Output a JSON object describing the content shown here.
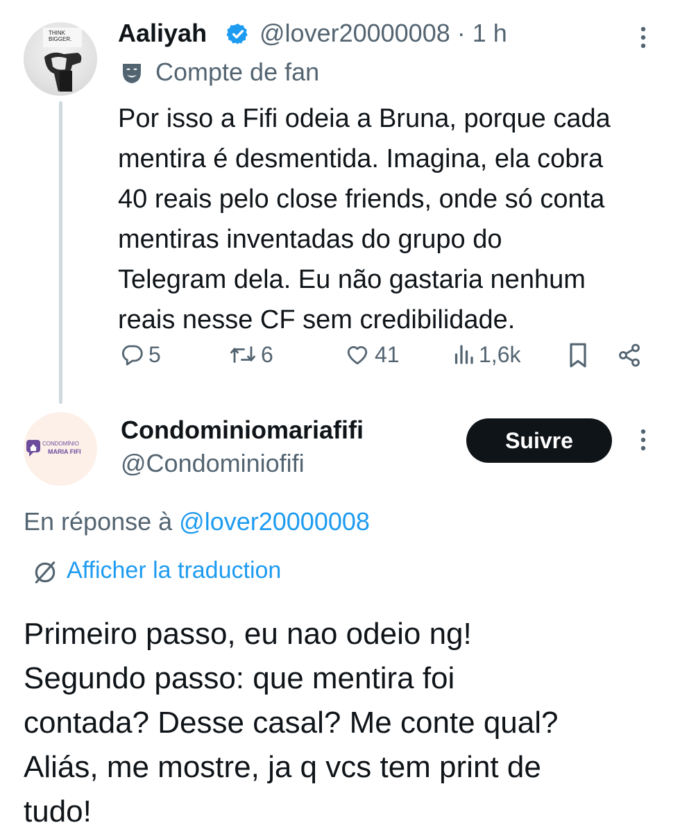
{
  "parent_tweet": {
    "avatar_text": [
      "THINK",
      "BIGGER."
    ],
    "display_name": "Aaliyah",
    "handle_time": "@lover20000008 · 1 h",
    "label": "Compte de fan",
    "text_lines": [
      "Por isso a Fifi odeia a Bruna, porque cada",
      "mentira é desmentida. Imagina, ela cobra",
      "40 reais pelo close friends, onde só conta",
      "mentiras inventadas do grupo do",
      "Telegram dela. Eu não gastaria nenhum",
      "reais nesse CF sem credibilidade."
    ],
    "stats": {
      "replies": "5",
      "reposts": "6",
      "likes": "41",
      "views": "1,6k"
    }
  },
  "reply_tweet": {
    "avatar_text": [
      "CONDOMÍNIO",
      "MARIA FIFI"
    ],
    "display_name": "Condominiomariafifi",
    "handle": "@Condominiofifi",
    "follow_label": "Suivre",
    "reply_prefix": "En réponse à ",
    "reply_mention": "@lover20000008",
    "translate_label": "Afficher la traduction",
    "text_lines": [
      "Primeiro passo, eu nao odeio ng!",
      "Segundo passo: que mentira foi",
      "contada? Desse casal? Me conte qual?",
      "Aliás, me mostre, ja q vcs tem print de",
      "tudo!"
    ]
  },
  "colors": {
    "text_primary": "#0f1419",
    "text_secondary": "#536471",
    "link_blue": "#1d9bf0",
    "verified_blue": "#1d9bf0",
    "button_dark": "#0f1419",
    "thread_line": "#cfd9de",
    "brand_purple": "#6c4c9c"
  },
  "icons": [
    "verified-badge-icon",
    "more-options-icon",
    "fan-mask-icon",
    "reply-icon",
    "repost-icon",
    "like-icon",
    "views-icon",
    "bookmark-icon",
    "share-icon",
    "translate-icon"
  ]
}
